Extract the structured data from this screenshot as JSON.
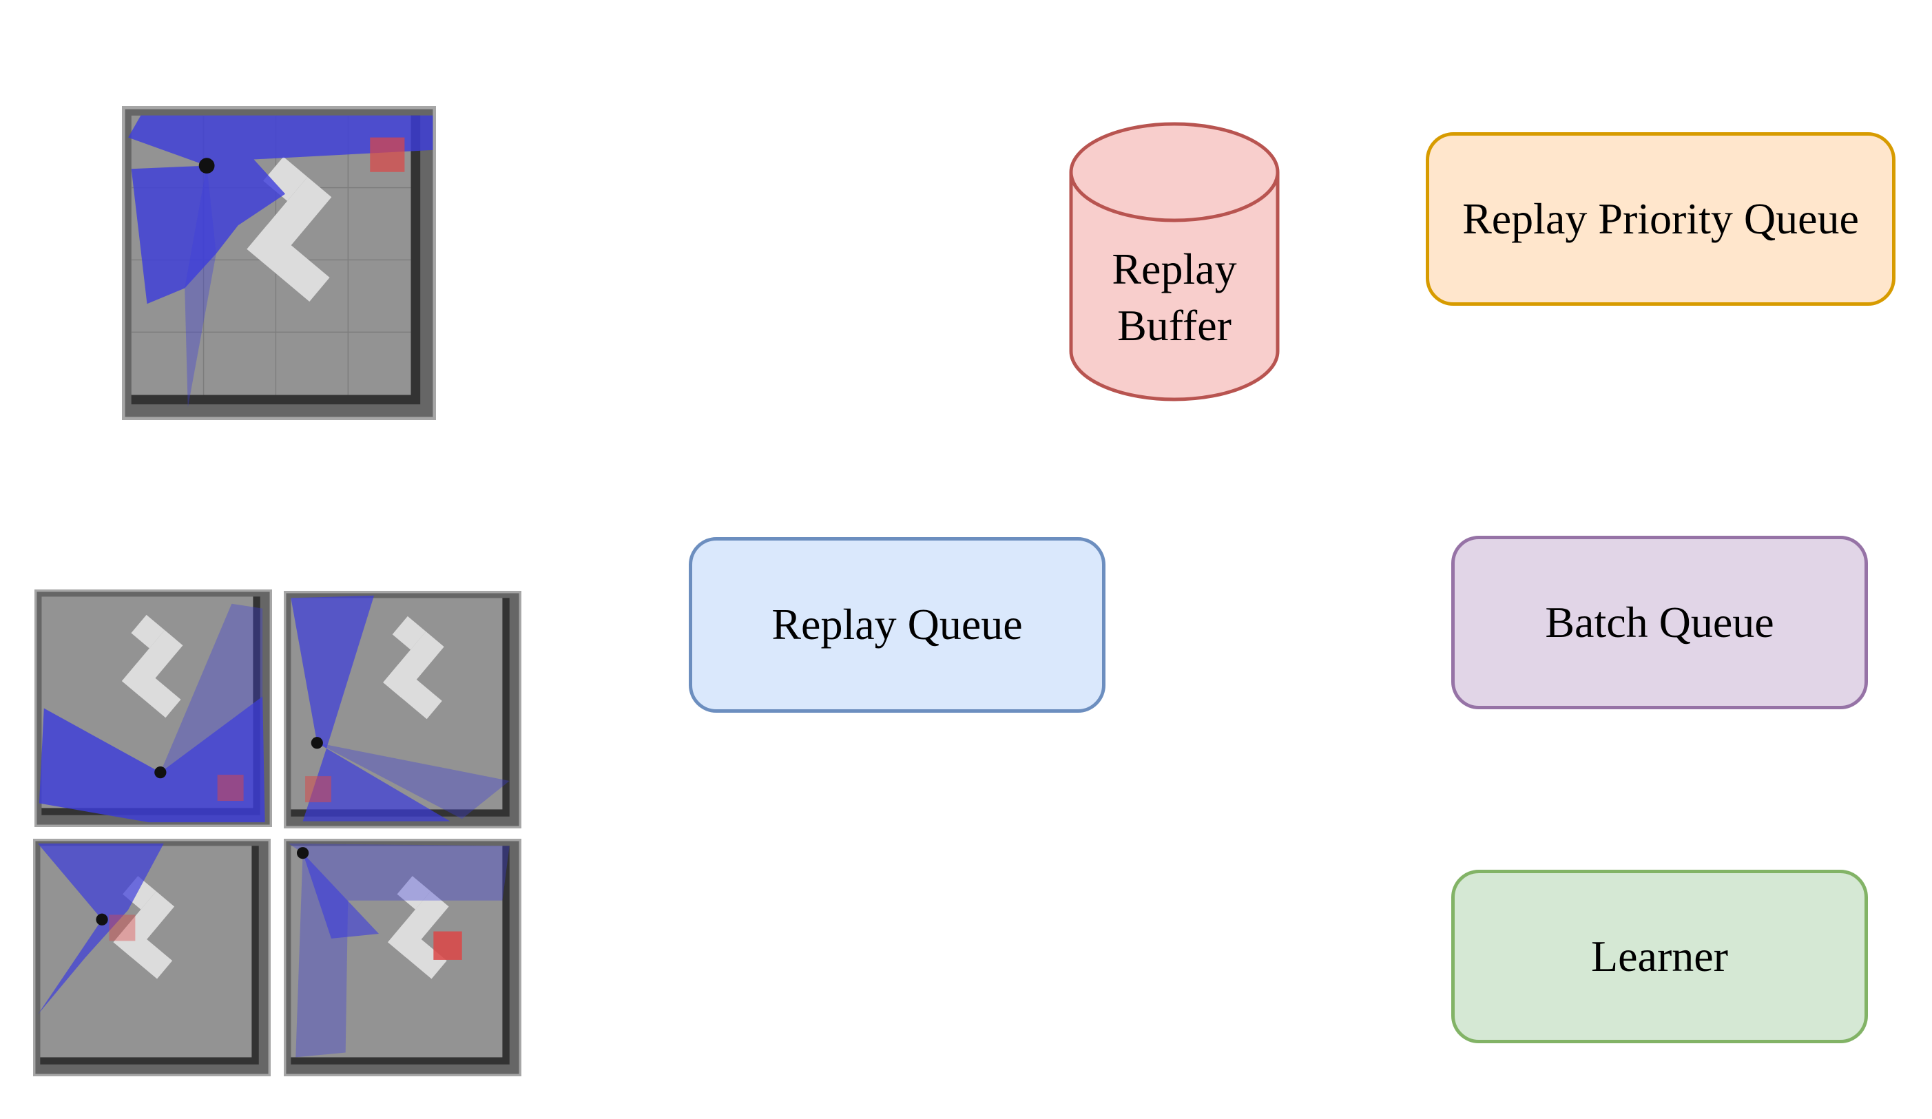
{
  "diagram": {
    "nodes": {
      "replay_buffer": {
        "label_line1": "Replay",
        "label_line2": "Buffer",
        "shape": "cylinder",
        "fill": "#f8cecc",
        "stroke": "#b85450"
      },
      "replay_priority_queue": {
        "label": "Replay Priority Queue",
        "fill": "#ffe6cc",
        "stroke": "#d79b00"
      },
      "replay_queue": {
        "label": "Replay Queue",
        "fill": "#dae8fc",
        "stroke": "#6c8ebf"
      },
      "batch_queue": {
        "label": "Batch Queue",
        "fill": "#e1d5e7",
        "stroke": "#9673a6"
      },
      "learner": {
        "label": "Learner",
        "fill": "#d5e8d4",
        "stroke": "#82b366"
      }
    },
    "environments": {
      "large": {
        "description": "robot lidar simulation arena (single)",
        "count": 1
      },
      "grid": {
        "description": "robot lidar simulation arenas (2x2)",
        "count": 4
      }
    },
    "colors": {
      "floor": "#939393",
      "wall": "#333333",
      "frame": "#666666",
      "obstacle": "#dcdcdc",
      "lidar": "#3c3cdc",
      "goal": "#dc4646"
    }
  }
}
